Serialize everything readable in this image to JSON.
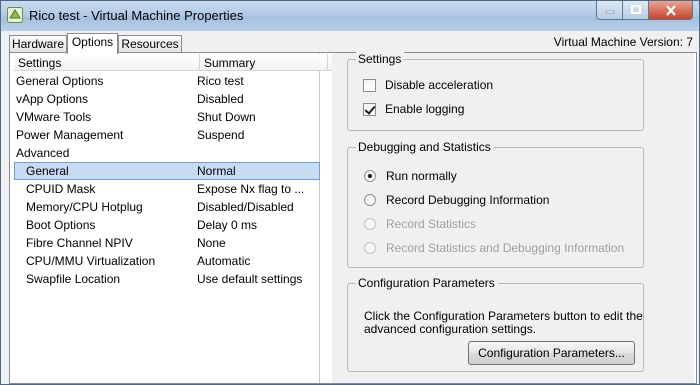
{
  "window": {
    "title": "Rico test - Virtual Machine Properties"
  },
  "tabs": [
    {
      "label": "Hardware"
    },
    {
      "label": "Options"
    },
    {
      "label": "Resources"
    }
  ],
  "vm_version": "Virtual Machine Version: 7",
  "list": {
    "headers": {
      "settings": "Settings",
      "summary": "Summary"
    },
    "rows": [
      {
        "setting": "General Options",
        "summary": "Rico test"
      },
      {
        "setting": "vApp Options",
        "summary": "Disabled"
      },
      {
        "setting": "VMware Tools",
        "summary": "Shut Down"
      },
      {
        "setting": "Power Management",
        "summary": "Suspend"
      },
      {
        "setting": "Advanced",
        "summary": ""
      },
      {
        "setting": "General",
        "summary": "Normal"
      },
      {
        "setting": "CPUID Mask",
        "summary": "Expose Nx flag to ..."
      },
      {
        "setting": "Memory/CPU Hotplug",
        "summary": "Disabled/Disabled"
      },
      {
        "setting": "Boot Options",
        "summary": "Delay 0 ms"
      },
      {
        "setting": "Fibre Channel NPIV",
        "summary": "None"
      },
      {
        "setting": "CPU/MMU Virtualization",
        "summary": "Automatic"
      },
      {
        "setting": "Swapfile Location",
        "summary": "Use default settings"
      }
    ]
  },
  "settings_group": {
    "title": "Settings",
    "disable_acceleration": {
      "label": "Disable acceleration",
      "checked": false
    },
    "enable_logging": {
      "label": "Enable logging",
      "checked": true
    }
  },
  "debug_group": {
    "title": "Debugging and Statistics",
    "options": [
      {
        "label": "Run normally",
        "selected": true,
        "enabled": true
      },
      {
        "label": "Record Debugging Information",
        "selected": false,
        "enabled": true
      },
      {
        "label": "Record Statistics",
        "selected": false,
        "enabled": false
      },
      {
        "label": "Record Statistics and Debugging Information",
        "selected": false,
        "enabled": false
      }
    ]
  },
  "config_group": {
    "title": "Configuration Parameters",
    "description": "Click the Configuration Parameters button to edit the advanced configuration settings.",
    "button_label": "Configuration Parameters..."
  },
  "colors": {
    "selection": "#c7dbf3",
    "titlebar": "#b3cbe6",
    "close_button": "#c7452c"
  }
}
